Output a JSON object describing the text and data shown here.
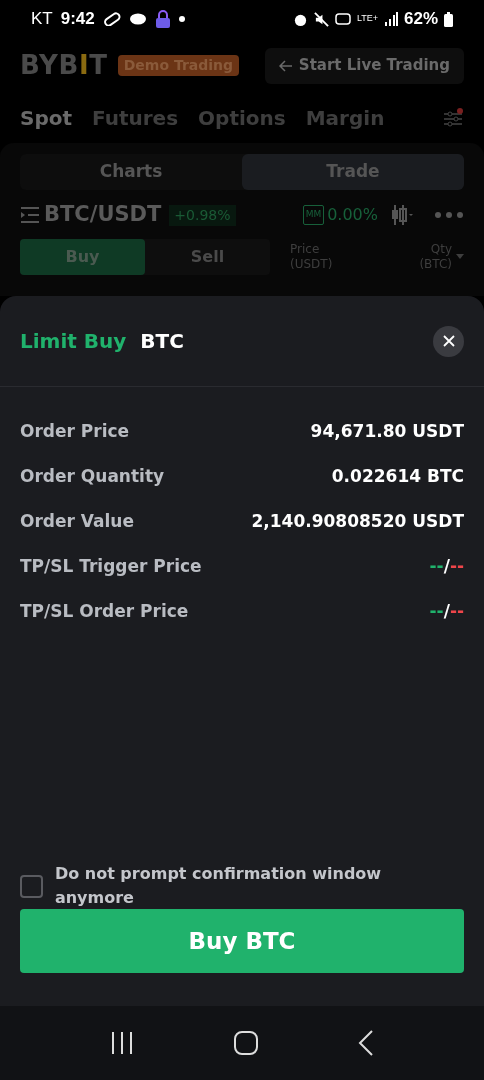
{
  "status_bar": {
    "carrier": "KT",
    "time": "9:42",
    "network": "LTE+",
    "battery": "62%"
  },
  "header": {
    "logo_parts": [
      "BYB",
      "I",
      "T"
    ],
    "badge": "Demo Trading",
    "live_button": "Start Live Trading"
  },
  "market_tabs": [
    {
      "label": "Spot",
      "selected": true
    },
    {
      "label": "Futures",
      "selected": false
    },
    {
      "label": "Options",
      "selected": false
    },
    {
      "label": "Margin",
      "selected": false
    }
  ],
  "view_tabs": [
    {
      "label": "Charts",
      "selected": false
    },
    {
      "label": "Trade",
      "selected": true
    }
  ],
  "pair": {
    "symbol": "BTC/USDT",
    "change": "+0.98%",
    "mm_label": "MM",
    "mm_value": "0.00%"
  },
  "side_tabs": [
    {
      "label": "Buy",
      "selected": true
    },
    {
      "label": "Sell",
      "selected": false
    }
  ],
  "book_columns": [
    {
      "name": "Price",
      "unit": "(USDT)"
    },
    {
      "name": "Qty",
      "unit": "(BTC)"
    }
  ],
  "dialog": {
    "title": "Limit Buy",
    "asset": "BTC",
    "rows": [
      {
        "label": "Order Price",
        "kind": "text",
        "value": "94,671.80 USDT"
      },
      {
        "label": "Order Quantity",
        "kind": "text",
        "value": "0.022614 BTC"
      },
      {
        "label": "Order Value",
        "kind": "text",
        "value": "2,140.90808520 USDT"
      },
      {
        "label": "TP/SL Trigger Price",
        "kind": "pair",
        "take_profit": "--",
        "separator": "/",
        "stop_loss": "--"
      },
      {
        "label": "TP/SL Order Price",
        "kind": "pair",
        "take_profit": "--",
        "separator": "/",
        "stop_loss": "--"
      }
    ],
    "dont_prompt": {
      "label": "Do not prompt confirmation window anymore",
      "checked": false
    },
    "confirm_button": "Buy BTC"
  }
}
